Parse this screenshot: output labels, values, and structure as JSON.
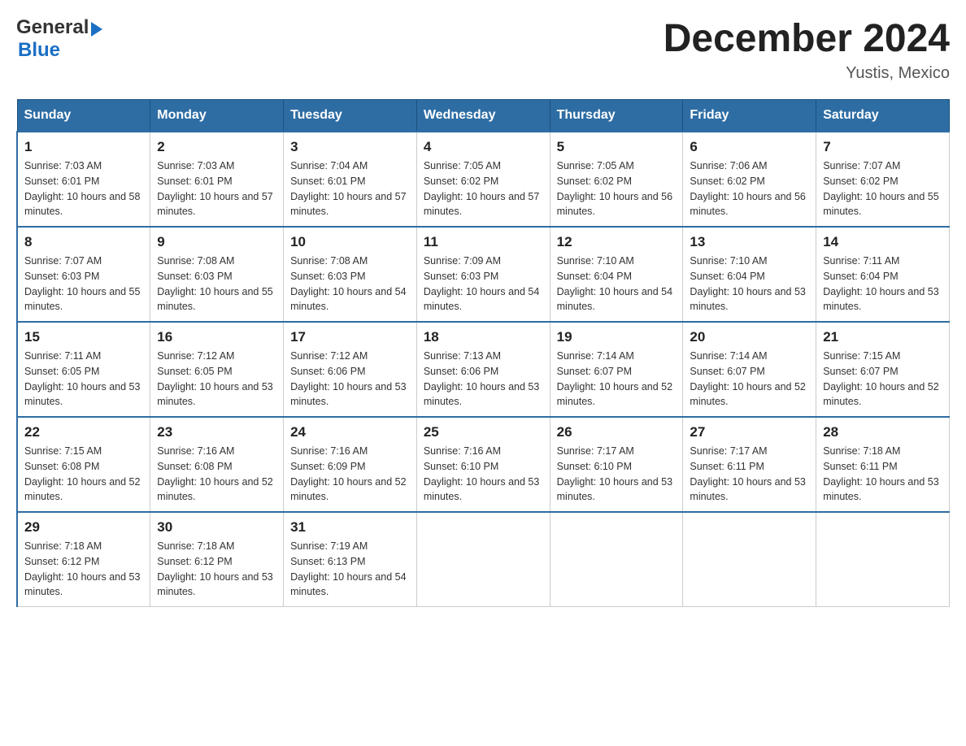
{
  "logo": {
    "text_general": "General",
    "arrow": "▶",
    "text_blue": "Blue"
  },
  "title": "December 2024",
  "location": "Yustis, Mexico",
  "days_of_week": [
    "Sunday",
    "Monday",
    "Tuesday",
    "Wednesday",
    "Thursday",
    "Friday",
    "Saturday"
  ],
  "weeks": [
    [
      {
        "day": 1,
        "sunrise": "7:03 AM",
        "sunset": "6:01 PM",
        "daylight": "10 hours and 58 minutes."
      },
      {
        "day": 2,
        "sunrise": "7:03 AM",
        "sunset": "6:01 PM",
        "daylight": "10 hours and 57 minutes."
      },
      {
        "day": 3,
        "sunrise": "7:04 AM",
        "sunset": "6:01 PM",
        "daylight": "10 hours and 57 minutes."
      },
      {
        "day": 4,
        "sunrise": "7:05 AM",
        "sunset": "6:02 PM",
        "daylight": "10 hours and 57 minutes."
      },
      {
        "day": 5,
        "sunrise": "7:05 AM",
        "sunset": "6:02 PM",
        "daylight": "10 hours and 56 minutes."
      },
      {
        "day": 6,
        "sunrise": "7:06 AM",
        "sunset": "6:02 PM",
        "daylight": "10 hours and 56 minutes."
      },
      {
        "day": 7,
        "sunrise": "7:07 AM",
        "sunset": "6:02 PM",
        "daylight": "10 hours and 55 minutes."
      }
    ],
    [
      {
        "day": 8,
        "sunrise": "7:07 AM",
        "sunset": "6:03 PM",
        "daylight": "10 hours and 55 minutes."
      },
      {
        "day": 9,
        "sunrise": "7:08 AM",
        "sunset": "6:03 PM",
        "daylight": "10 hours and 55 minutes."
      },
      {
        "day": 10,
        "sunrise": "7:08 AM",
        "sunset": "6:03 PM",
        "daylight": "10 hours and 54 minutes."
      },
      {
        "day": 11,
        "sunrise": "7:09 AM",
        "sunset": "6:03 PM",
        "daylight": "10 hours and 54 minutes."
      },
      {
        "day": 12,
        "sunrise": "7:10 AM",
        "sunset": "6:04 PM",
        "daylight": "10 hours and 54 minutes."
      },
      {
        "day": 13,
        "sunrise": "7:10 AM",
        "sunset": "6:04 PM",
        "daylight": "10 hours and 53 minutes."
      },
      {
        "day": 14,
        "sunrise": "7:11 AM",
        "sunset": "6:04 PM",
        "daylight": "10 hours and 53 minutes."
      }
    ],
    [
      {
        "day": 15,
        "sunrise": "7:11 AM",
        "sunset": "6:05 PM",
        "daylight": "10 hours and 53 minutes."
      },
      {
        "day": 16,
        "sunrise": "7:12 AM",
        "sunset": "6:05 PM",
        "daylight": "10 hours and 53 minutes."
      },
      {
        "day": 17,
        "sunrise": "7:12 AM",
        "sunset": "6:06 PM",
        "daylight": "10 hours and 53 minutes."
      },
      {
        "day": 18,
        "sunrise": "7:13 AM",
        "sunset": "6:06 PM",
        "daylight": "10 hours and 53 minutes."
      },
      {
        "day": 19,
        "sunrise": "7:14 AM",
        "sunset": "6:07 PM",
        "daylight": "10 hours and 52 minutes."
      },
      {
        "day": 20,
        "sunrise": "7:14 AM",
        "sunset": "6:07 PM",
        "daylight": "10 hours and 52 minutes."
      },
      {
        "day": 21,
        "sunrise": "7:15 AM",
        "sunset": "6:07 PM",
        "daylight": "10 hours and 52 minutes."
      }
    ],
    [
      {
        "day": 22,
        "sunrise": "7:15 AM",
        "sunset": "6:08 PM",
        "daylight": "10 hours and 52 minutes."
      },
      {
        "day": 23,
        "sunrise": "7:16 AM",
        "sunset": "6:08 PM",
        "daylight": "10 hours and 52 minutes."
      },
      {
        "day": 24,
        "sunrise": "7:16 AM",
        "sunset": "6:09 PM",
        "daylight": "10 hours and 52 minutes."
      },
      {
        "day": 25,
        "sunrise": "7:16 AM",
        "sunset": "6:10 PM",
        "daylight": "10 hours and 53 minutes."
      },
      {
        "day": 26,
        "sunrise": "7:17 AM",
        "sunset": "6:10 PM",
        "daylight": "10 hours and 53 minutes."
      },
      {
        "day": 27,
        "sunrise": "7:17 AM",
        "sunset": "6:11 PM",
        "daylight": "10 hours and 53 minutes."
      },
      {
        "day": 28,
        "sunrise": "7:18 AM",
        "sunset": "6:11 PM",
        "daylight": "10 hours and 53 minutes."
      }
    ],
    [
      {
        "day": 29,
        "sunrise": "7:18 AM",
        "sunset": "6:12 PM",
        "daylight": "10 hours and 53 minutes."
      },
      {
        "day": 30,
        "sunrise": "7:18 AM",
        "sunset": "6:12 PM",
        "daylight": "10 hours and 53 minutes."
      },
      {
        "day": 31,
        "sunrise": "7:19 AM",
        "sunset": "6:13 PM",
        "daylight": "10 hours and 54 minutes."
      },
      null,
      null,
      null,
      null
    ]
  ]
}
